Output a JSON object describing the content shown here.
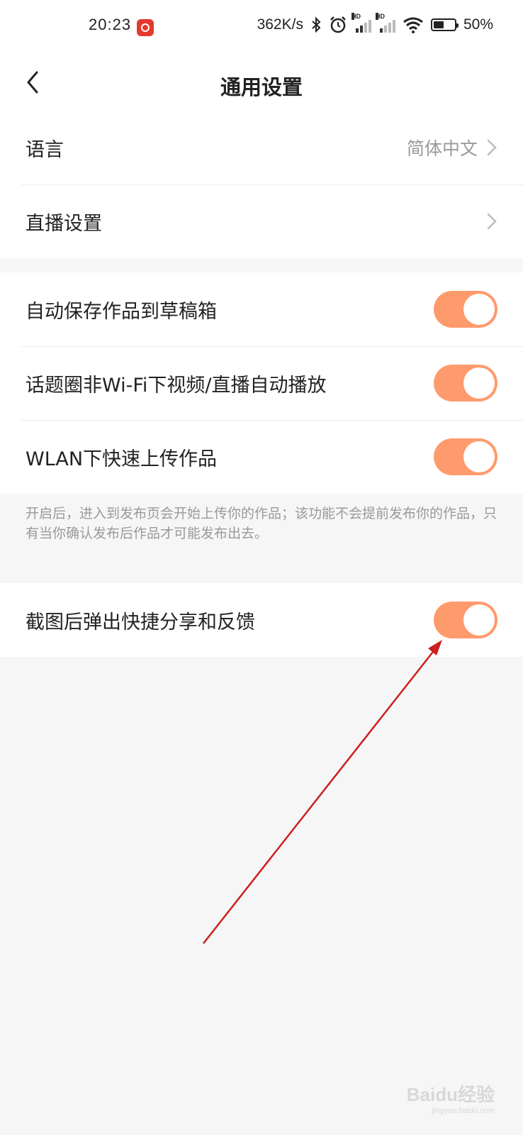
{
  "status_bar": {
    "time": "20:23",
    "speed": "362K/s",
    "battery": "50%",
    "icons": [
      "app-notification-icon",
      "bluetooth-icon",
      "alarm-icon",
      "signal-hd-icon",
      "signal-hd-icon",
      "wifi-icon",
      "battery-icon"
    ]
  },
  "nav": {
    "back_icon": "chevron-left-icon",
    "title": "通用设置"
  },
  "group1": [
    {
      "label": "语言",
      "value": "简体中文"
    },
    {
      "label": "直播设置",
      "value": ""
    }
  ],
  "group2": [
    {
      "label": "自动保存作品到草稿箱",
      "on": true
    },
    {
      "label": "话题圈非Wi-Fi下视频/直播自动播放",
      "on": true
    },
    {
      "label": "WLAN下快速上传作品",
      "on": true
    }
  ],
  "note": "开启后，进入到发布页会开始上传你的作品；该功能不会提前发布你的作品，只有当你确认发布后作品才可能发布出去。",
  "group3": [
    {
      "label": "截图后弹出快捷分享和反馈",
      "on": true
    }
  ],
  "watermark": {
    "brand": "Baidu经验",
    "url": "jingyan.baidu.com"
  },
  "colors": {
    "toggle_on": "#ff9a6c",
    "annotation_arrow": "#cc1f1f",
    "background": "#f6f6f6"
  }
}
